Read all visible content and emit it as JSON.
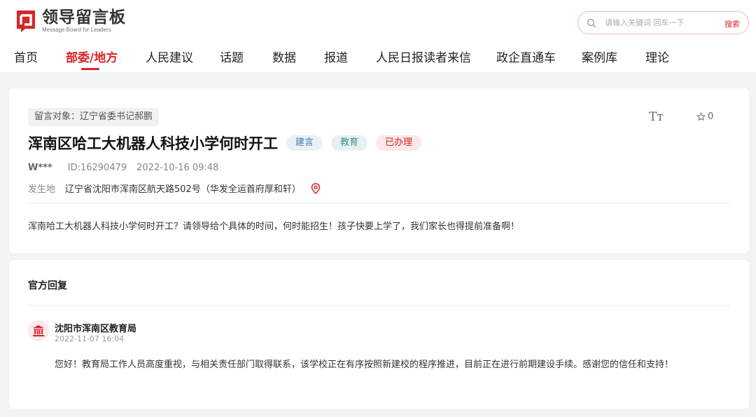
{
  "header": {
    "logo_cn": "领导留言板",
    "logo_en": "Message Board for Leaders",
    "search_placeholder": "请输入关键词 回车一下",
    "search_button": "搜索"
  },
  "nav": {
    "items": [
      {
        "label": "首页"
      },
      {
        "label": "部委/地方"
      },
      {
        "label": "人民建议"
      },
      {
        "label": "话题"
      },
      {
        "label": "数据"
      },
      {
        "label": "报道"
      },
      {
        "label": "人民日报读者来信"
      },
      {
        "label": "政企直通车"
      },
      {
        "label": "案例库"
      },
      {
        "label": "理论"
      }
    ],
    "active_index": 1
  },
  "message": {
    "target": "留言对象：辽宁省委书记郝鹏",
    "font_icon_label": "Tт",
    "favorite_count": "0",
    "title": "浑南区哈工大机器人科技小学何时开工",
    "tags": [
      "建言",
      "教育",
      "已办理"
    ],
    "user": "W***",
    "id": "ID:16290479",
    "datetime": "2022-10-16 09:48",
    "location_label": "发生地",
    "location_value": "辽宁省沈阳市浑南区航天路502号（华发全运首府厚和轩）",
    "content": "浑南哈工大机器人科技小学何时开工？请领导给个具体的时间，何时能招生！孩子快要上学了，我们家长也得提前准备啊！"
  },
  "reply": {
    "section_title": "官方回复",
    "org_name": "沈阳市浑南区教育局",
    "datetime": "2022-11-07 16:04",
    "content": "您好！教育局工作人员高度重视，与相关责任部门取得联系，该学校正在有序按照新建校的程序推进，目前正在进行前期建设手续。感谢您的信任和支持！"
  },
  "colors": {
    "brand": "#d6252b",
    "background": "#f2f3f5"
  },
  "icons": {
    "logo": "message-board-logo",
    "search": "search-icon",
    "font_size": "font-size-icon",
    "favorite": "star-icon",
    "location": "location-pin-icon",
    "org": "government-building-icon"
  }
}
